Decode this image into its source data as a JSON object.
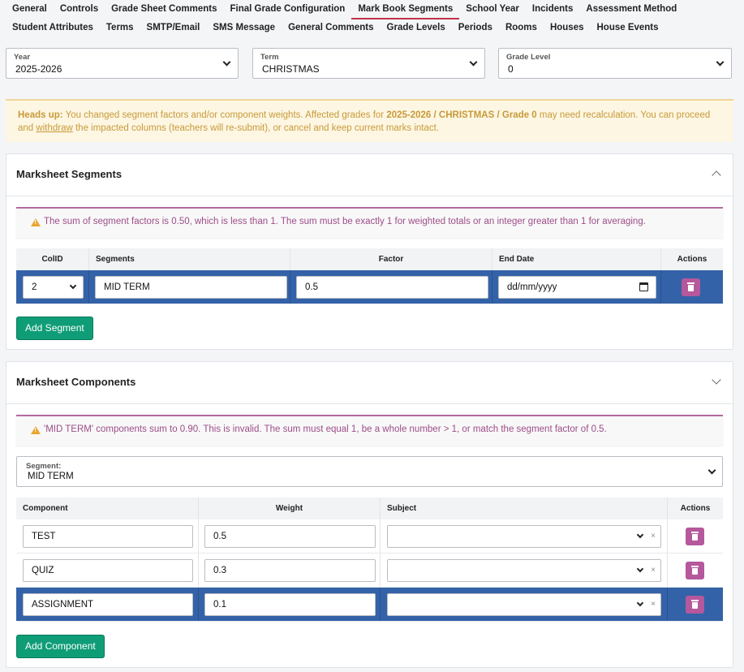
{
  "tabs": {
    "row1": [
      "General",
      "Controls",
      "Grade Sheet Comments",
      "Final Grade Configuration",
      "Mark Book Segments",
      "School Year",
      "Incidents",
      "Assessment Method"
    ],
    "row2": [
      "Student Attributes",
      "Terms",
      "SMTP/Email",
      "SMS Message",
      "General Comments",
      "Grade Levels",
      "Periods",
      "Rooms",
      "Houses",
      "House Events"
    ],
    "active": "Mark Book Segments"
  },
  "filters": {
    "year": {
      "label": "Year",
      "value": "2025-2026"
    },
    "term": {
      "label": "Term",
      "value": "CHRISTMAS"
    },
    "grade_level": {
      "label": "Grade Level",
      "value": "0"
    }
  },
  "alert": {
    "prefix": "Heads up:",
    "text1": " You changed segment factors and/or component weights. Affected grades for ",
    "year": "2025-2026",
    "sep1": " / ",
    "term": "CHRISTMAS",
    "sep2": " / ",
    "grade": "Grade 0",
    "text2": " may need recalculation. You can proceed and ",
    "withdraw": "withdraw",
    "text3": " the impacted columns (teachers will re-submit), or cancel and keep current marks intact."
  },
  "segments": {
    "title": "Marksheet Segments",
    "warning": "The sum of segment factors is 0.50, which is less than 1. The sum must be exactly 1 for weighted totals or an integer greater than 1 for averaging.",
    "headers": {
      "colid": "ColID",
      "segments": "Segments",
      "factor": "Factor",
      "end_date": "End Date",
      "actions": "Actions"
    },
    "rows": [
      {
        "colid": "2",
        "segment": "MID TERM",
        "factor": "0.5",
        "end_date": "dd/mm/yyyy"
      }
    ],
    "add_button": "Add Segment"
  },
  "components": {
    "title": "Marksheet Components",
    "warning": "'MID TERM' components sum to 0.90. This is invalid. The sum must equal 1, be a whole number > 1, or match the segment factor of 0.5.",
    "segment_select": {
      "label": "Segment:",
      "value": "MID TERM"
    },
    "headers": {
      "component": "Component",
      "weight": "Weight",
      "subject": "Subject",
      "actions": "Actions"
    },
    "rows": [
      {
        "component": "TEST",
        "weight": "0.5",
        "subject": ""
      },
      {
        "component": "QUIZ",
        "weight": "0.3",
        "subject": ""
      },
      {
        "component": "ASSIGNMENT",
        "weight": "0.1",
        "subject": ""
      }
    ],
    "selected_row": 2,
    "add_button": "Add Component"
  },
  "colors": {
    "selected_row": "#3462a8",
    "add_button": "#0f9d77",
    "delete_button": "#b5589c",
    "active_tab_underline": "#c0334a",
    "alert_text": "#c89a38",
    "warning_text": "#9d4d86"
  }
}
